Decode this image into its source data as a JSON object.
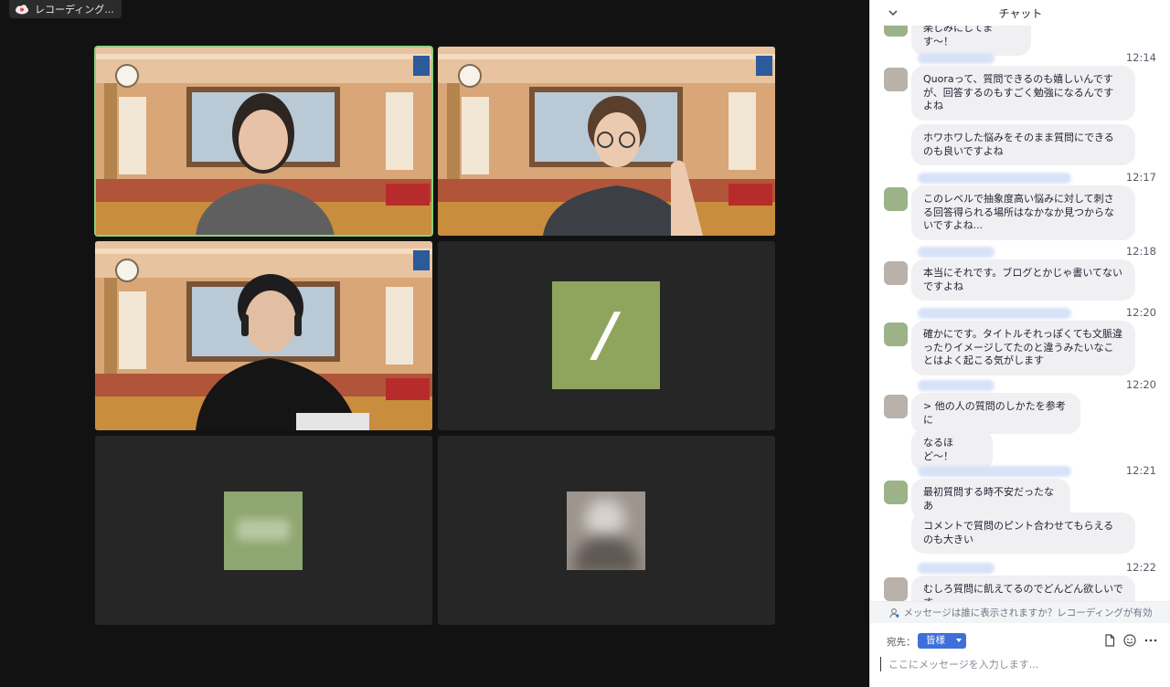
{
  "recording": {
    "label": "レコーディング..."
  },
  "chat": {
    "title": "チャット",
    "partial_message": "楽しみにしてます〜！",
    "groups": [
      {
        "time": "12:14",
        "avatar": "gray",
        "messages": [
          "Quoraって、質問できるのも嬉しいんですが、回答するのもすごく勉強になるんですよね",
          "ホワホワした悩みをそのまま質問にできるのも良いですよね"
        ]
      },
      {
        "time": "12:17",
        "avatar": "green",
        "messages": [
          "このレベルで抽象度高い悩みに対して刺さる回答得られる場所はなかなか見つからないですよね..."
        ]
      },
      {
        "time": "12:18",
        "avatar": "gray",
        "messages": [
          "本当にそれです。ブログとかじゃ書いてないですよね"
        ]
      },
      {
        "time": "12:20",
        "avatar": "green",
        "messages": [
          "確かにです。タイトルそれっぽくても文脈違ったりイメージしてたのと違うみたいなことはよく起こる気がします"
        ]
      },
      {
        "time": "12:20",
        "avatar": "gray",
        "messages": [
          "> 他の人の質問のしかたを参考に",
          "なるほど〜！"
        ]
      },
      {
        "time": "12:21",
        "avatar": "green",
        "messages": [
          "最初質問する時不安だったなあ",
          "コメントで質問のピント合わせてもらえるのも大きい"
        ]
      },
      {
        "time": "12:22",
        "avatar": "gray",
        "messages": [
          "むしろ質問に飢えてるのでどんどん欲しいです"
        ]
      }
    ],
    "notice": "メッセージは誰に表示されますか？レコーディングが有効",
    "to_label": "宛先：",
    "to_value": "皆様",
    "input_placeholder": "ここにメッセージを入力します..."
  },
  "tiles": {
    "t4_slash": "/"
  },
  "colors": {
    "active_speaker": "#8bd17c",
    "avatar_green": "#8fa55e",
    "to_select": "#3f6fd8"
  }
}
